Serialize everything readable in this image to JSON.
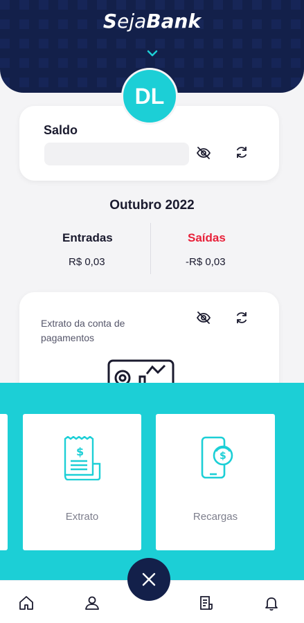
{
  "header": {
    "brand_part1": "S",
    "brand_part2": "eja",
    "brand_part3": "Bank",
    "avatar_initials": "DL"
  },
  "balance": {
    "title": "Saldo"
  },
  "summary": {
    "month": "Outubro 2022",
    "income_label": "Entradas",
    "income_value": "R$ 0,03",
    "expense_label": "Saídas",
    "expense_value": "-R$ 0,03",
    "expense_color": "#e8213a"
  },
  "statement": {
    "text": "Extrato da conta de pagamentos"
  },
  "quick_actions": [
    {
      "label": "Extrato",
      "icon": "receipt-icon"
    },
    {
      "label": "Recargas",
      "icon": "phone-recharge-icon"
    }
  ],
  "colors": {
    "navy": "#13204a",
    "teal": "#1ccfd6"
  },
  "bottom_nav": [
    "home-icon",
    "profile-icon",
    "document-icon",
    "bell-icon"
  ]
}
